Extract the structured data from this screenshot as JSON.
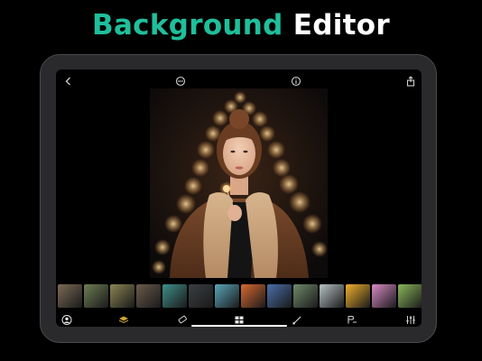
{
  "headline": {
    "accent_word": "Background",
    "plain_word": "Editor",
    "accent_color": "#1fbf9c"
  },
  "toolbar_top": {
    "icons": [
      "back-icon",
      "compare-icon",
      "info-icon",
      "share-icon"
    ]
  },
  "background_thumbnails": [
    {
      "name": "people-scene",
      "color": "#7c6a55"
    },
    {
      "name": "autumn-leaves",
      "color": "#6e7d52"
    },
    {
      "name": "trees-blossom",
      "color": "#8c8450"
    },
    {
      "name": "forest-path",
      "color": "#6a5a4a"
    },
    {
      "name": "teal-marble",
      "color": "#3f8f8a"
    },
    {
      "name": "dark-rocks",
      "color": "#3b3f42"
    },
    {
      "name": "ocean-waves",
      "color": "#5aa5b8"
    },
    {
      "name": "swirl-colors",
      "color": "#d86a2f"
    },
    {
      "name": "abstract-blue",
      "color": "#4a6ea8"
    },
    {
      "name": "green-landscape",
      "color": "#6f8a6a"
    },
    {
      "name": "misty-sky",
      "color": "#b7c1c4"
    },
    {
      "name": "sunset-gradient",
      "color": "#f0b02c"
    },
    {
      "name": "pink-gradient",
      "color": "#d88ac4"
    },
    {
      "name": "meadow",
      "color": "#8ab65a"
    }
  ],
  "toolbar_bottom": {
    "icons": [
      "person-icon",
      "layers-icon",
      "eraser-icon",
      "backgrounds-icon",
      "brush-icon",
      "text-icon",
      "adjust-icon"
    ],
    "active": "backgrounds-icon"
  }
}
